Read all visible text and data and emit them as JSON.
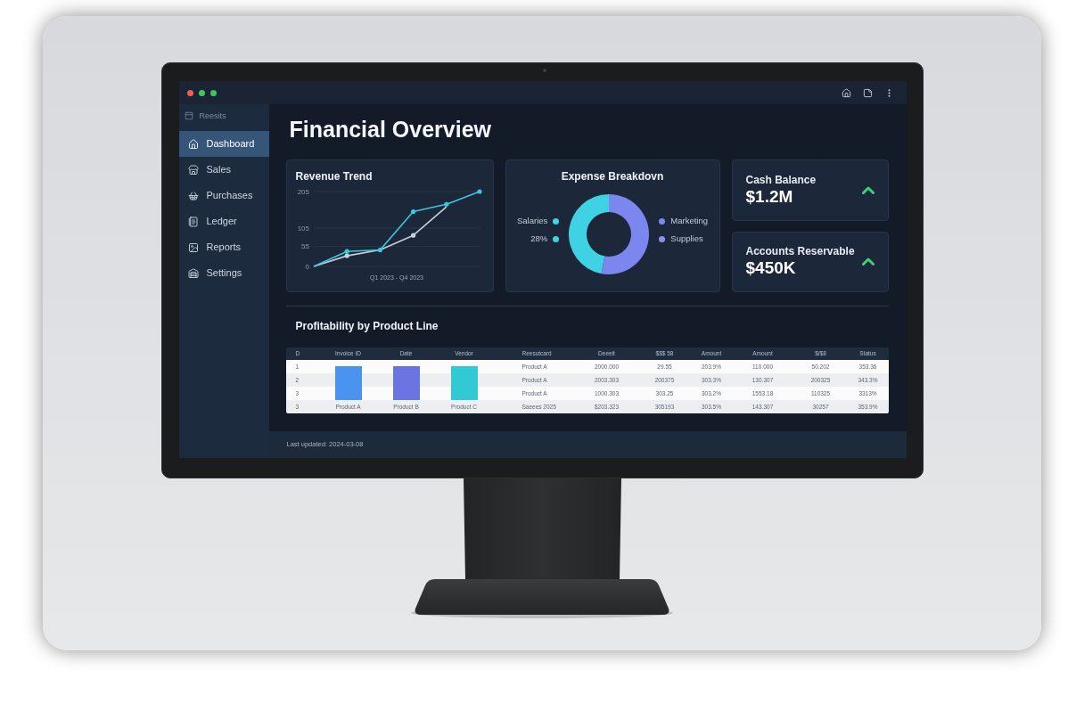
{
  "sidebar": {
    "header": "Reesits",
    "items": [
      {
        "label": "Dashboard",
        "selected": true
      },
      {
        "label": "Sales",
        "selected": false
      },
      {
        "label": "Purchases",
        "selected": false
      },
      {
        "label": "Ledger",
        "selected": false
      },
      {
        "label": "Reports",
        "selected": false
      },
      {
        "label": "Settings",
        "selected": false
      }
    ]
  },
  "page_title": "Financial Overview",
  "revenue_trend": {
    "chart_data": {
      "type": "line",
      "title": "Revenue Trend",
      "xlabel": "Q1 2023 - Q4 2023",
      "categories": [
        null,
        null,
        null,
        null,
        null,
        null
      ],
      "grid": true,
      "ylim": [
        0,
        205
      ],
      "yticks": [
        {
          "value": 0,
          "label": "0"
        },
        {
          "value": 55,
          "label": "55"
        },
        {
          "value": 105,
          "label": "105"
        },
        {
          "value": 205,
          "label": "205"
        }
      ],
      "series": [
        {
          "color": "#3cc8dc",
          "values": [
            0,
            41,
            45,
            150,
            170,
            205
          ]
        },
        {
          "color": "#c9ced6",
          "values": [
            0,
            29,
            45,
            85,
            163,
            null
          ]
        }
      ]
    }
  },
  "expense_breakdown": {
    "chart_data": {
      "type": "donut",
      "title": "Expense Breakdovn",
      "values": [
        47,
        53
      ]
    },
    "legend_left": [
      {
        "label": "Salaries",
        "color": "#3fd2e3"
      },
      {
        "label": "28%",
        "color": "#3fd2e3"
      }
    ],
    "legend_right": [
      {
        "label": "Marketing",
        "color": "#7c86ef"
      },
      {
        "label": "Supplies",
        "color": "#8a92f0"
      }
    ]
  },
  "kpis": [
    {
      "label": "Cash Balance",
      "value": "$1.2M",
      "rising": true
    },
    {
      "label": "Accounts Reservable",
      "value": "$450K",
      "rising": true
    }
  ],
  "profitability": {
    "title": "Profitability by Product Line",
    "table": {
      "columns": [
        "D",
        "Invoice ID",
        "Date",
        "Vendor",
        "Reesutcard",
        "Deeeit",
        "$$$ 58",
        "Amount",
        "Amount",
        "$/$8",
        "Status"
      ],
      "bars": [
        {
          "color": "#4a93ee"
        },
        {
          "color": "#6b74e3"
        },
        {
          "color": "#31c9d4"
        }
      ],
      "rows": [
        {
          "cells": [
            "1",
            "",
            "",
            "",
            "Product A",
            "2000.000",
            "29.55",
            "203.9%",
            "110.000",
            "50.202",
            "353.36"
          ]
        },
        {
          "cells": [
            "2",
            "",
            "",
            "",
            "Product A",
            "2003.303",
            "200375",
            "303.3%",
            "130.307",
            "200325",
            "343.3%"
          ]
        },
        {
          "cells": [
            "3",
            "",
            "",
            "",
            "Product A",
            "1000.303",
            "303.25",
            "303.2%",
            "1553.18",
            "110325",
            "3313%"
          ]
        },
        {
          "cells": [
            "3",
            "Product A",
            "Product B",
            "Product C",
            "Saeees 2025",
            "$203.323",
            "305193",
            "303.5%",
            "143.307",
            "30257",
            "353.9%"
          ]
        }
      ]
    }
  },
  "status_bar": {
    "text": "Last updated: 2024-03-08"
  }
}
